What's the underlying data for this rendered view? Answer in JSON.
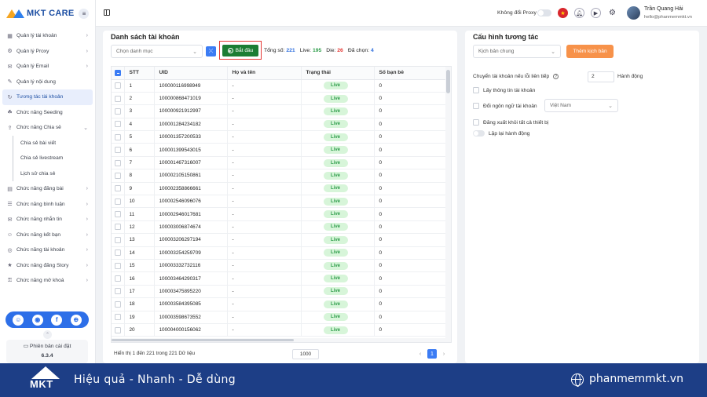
{
  "app": {
    "logo_text": "MKT CARE"
  },
  "sidebar": {
    "items": [
      {
        "icon": "grid-icon",
        "label": "Quản lý tài khoản"
      },
      {
        "icon": "proxy-icon",
        "label": "Quản lý Proxy"
      },
      {
        "icon": "mail-icon",
        "label": "Quản lý Email"
      },
      {
        "icon": "content-icon",
        "label": "Quản lý nội dung"
      },
      {
        "icon": "interact-icon",
        "label": "Tương tác tài khoản"
      },
      {
        "icon": "seeding-icon",
        "label": "Chức năng Seeding"
      },
      {
        "icon": "share-icon",
        "label": "Chức năng Chia sẻ"
      }
    ],
    "sub_items": [
      {
        "label": "Chia sẻ bài viết"
      },
      {
        "label": "Chia sẻ livestream"
      },
      {
        "label": "Lịch sử chia sẻ"
      }
    ],
    "items_after": [
      {
        "icon": "post-icon",
        "label": "Chức năng đăng bài"
      },
      {
        "icon": "comment-icon",
        "label": "Chức năng bình luận"
      },
      {
        "icon": "message-icon",
        "label": "Chức năng nhắn tin"
      },
      {
        "icon": "friend-icon",
        "label": "Chức năng kết bạn"
      },
      {
        "icon": "account-icon",
        "label": "Chức năng tài khoản"
      },
      {
        "icon": "story-icon",
        "label": "Chức năng đăng Story"
      },
      {
        "icon": "unlock-icon",
        "label": "Chức năng mở khoá"
      }
    ],
    "version_label": "Phiên bản cài đặt",
    "version": "6.3.4"
  },
  "topbar": {
    "proxy_label": "Không đổi Proxy",
    "user_name": "Trần Quang Hải",
    "user_email": "hello@phanmemmkt.vn"
  },
  "list_panel": {
    "title": "Danh sách tài khoản",
    "category_placeholder": "Chọn danh mục",
    "start_label": "Bắt đầu",
    "total_label": "Tổng số:",
    "total": "221",
    "live_label": "Live:",
    "live": "195",
    "die_label": "Die:",
    "die": "26",
    "selected_label": "Đã chọn:",
    "selected": "4",
    "columns": {
      "stt": "STT",
      "uid": "UID",
      "name": "Họ và tên",
      "status": "Trạng thái",
      "friends": "Số bạn bè"
    },
    "rows": [
      {
        "stt": "1",
        "uid": "100000116998949",
        "name": "-",
        "status": "Live",
        "friends": "0"
      },
      {
        "stt": "2",
        "uid": "100000868471019",
        "name": "-",
        "status": "Live",
        "friends": "0"
      },
      {
        "stt": "3",
        "uid": "100000921912997",
        "name": "-",
        "status": "Live",
        "friends": "0"
      },
      {
        "stt": "4",
        "uid": "100001284234182",
        "name": "-",
        "status": "Live",
        "friends": "0"
      },
      {
        "stt": "5",
        "uid": "100001357200533",
        "name": "-",
        "status": "Live",
        "friends": "0"
      },
      {
        "stt": "6",
        "uid": "100001399543015",
        "name": "-",
        "status": "Live",
        "friends": "0"
      },
      {
        "stt": "7",
        "uid": "100001467316007",
        "name": "-",
        "status": "Live",
        "friends": "0"
      },
      {
        "stt": "8",
        "uid": "100002105150861",
        "name": "-",
        "status": "Live",
        "friends": "0"
      },
      {
        "stt": "9",
        "uid": "100002358866661",
        "name": "-",
        "status": "Live",
        "friends": "0"
      },
      {
        "stt": "10",
        "uid": "100002546096076",
        "name": "-",
        "status": "Live",
        "friends": "0"
      },
      {
        "stt": "11",
        "uid": "100002946017681",
        "name": "-",
        "status": "Live",
        "friends": "0"
      },
      {
        "stt": "12",
        "uid": "100003006874674",
        "name": "-",
        "status": "Live",
        "friends": "0"
      },
      {
        "stt": "13",
        "uid": "100003206297194",
        "name": "-",
        "status": "Live",
        "friends": "0"
      },
      {
        "stt": "14",
        "uid": "100003254259709",
        "name": "-",
        "status": "Live",
        "friends": "0"
      },
      {
        "stt": "15",
        "uid": "100003332732116",
        "name": "-",
        "status": "Live",
        "friends": "0"
      },
      {
        "stt": "16",
        "uid": "100003464290317",
        "name": "-",
        "status": "Live",
        "friends": "0"
      },
      {
        "stt": "17",
        "uid": "100003475895220",
        "name": "-",
        "status": "Live",
        "friends": "0"
      },
      {
        "stt": "18",
        "uid": "100003584395085",
        "name": "-",
        "status": "Live",
        "friends": "0"
      },
      {
        "stt": "19",
        "uid": "100003598673552",
        "name": "-",
        "status": "Live",
        "friends": "0"
      },
      {
        "stt": "20",
        "uid": "100004000156062",
        "name": "-",
        "status": "Live",
        "friends": "0"
      }
    ],
    "footer_info": "Hiển thị 1 đến 221 trong 221 Dữ liệu",
    "page_size": "1000",
    "current_page": "1"
  },
  "config_panel": {
    "title": "Cấu hình tương tác",
    "script_select": "Kịch bản chung",
    "add_script_label": "Thêm kịch bản",
    "switch_label": "Chuyển tài khoản nếu lỗi liên tiếp",
    "switch_value": "2",
    "switch_suffix": "Hành động",
    "get_info_label": "Lấy thông tin tài khoản",
    "change_lang_label": "Đổi ngôn ngữ tài khoản",
    "language": "Việt Nam",
    "logout_label": "Đăng xuất khỏi tất cả thiết bị",
    "repeat_label": "Lặp lại hành động"
  },
  "banner": {
    "logo_text": "MKT",
    "slogan": "Hiệu quả - Nhanh - Dễ dùng",
    "site": "phanmemmkt.vn"
  },
  "colors": {
    "primary": "#3b7cf4",
    "start_button": "#1b7d34",
    "orange_button": "#f7924a",
    "live": "#2e9d4a",
    "die": "#e53935",
    "banner": "#1d3e86"
  }
}
